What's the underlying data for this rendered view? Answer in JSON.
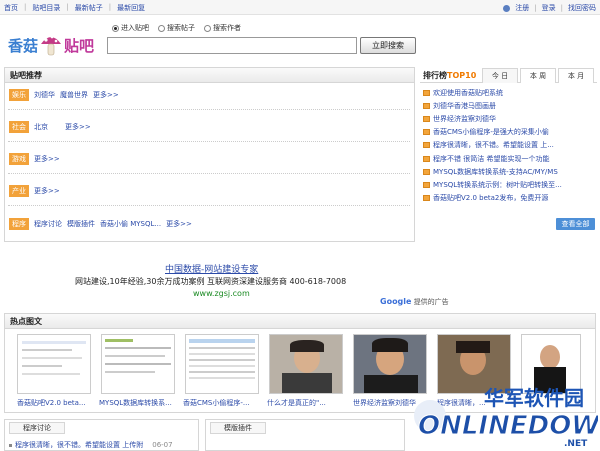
{
  "topbar": {
    "links": [
      "首页",
      "贴吧目录",
      "最新帖子",
      "最新回复"
    ],
    "register": "注册",
    "login": "登录",
    "recover": "找回密码"
  },
  "logo": {
    "part1": "香菇",
    "part2": "贴吧"
  },
  "search": {
    "options": [
      "进入贴吧",
      "搜索帖子",
      "搜索作者"
    ],
    "value": "",
    "button": "立即搜索"
  },
  "recommend": {
    "title": "贴吧推荐",
    "rows": [
      {
        "tag": "娱乐",
        "items": [
          "刘德华",
          "魔兽世界",
          "更多>>"
        ]
      },
      {
        "tag": "社会",
        "items": [
          "北京",
          "更多>>"
        ]
      },
      {
        "tag": "游戏",
        "items": [
          "更多>>"
        ]
      },
      {
        "tag": "产业",
        "items": [
          "更多>>"
        ]
      },
      {
        "tag": "程序",
        "items": [
          "程序讨论",
          "模版插件",
          "香菇小偷 MYSQL...",
          "更多>>"
        ]
      }
    ]
  },
  "rank": {
    "title": "排行榜",
    "title_hl": "TOP10",
    "tabs": [
      "今 日",
      "本 周",
      "本 月"
    ],
    "items": [
      "欢迎使用香菇贴吧系统",
      "刘德华香港马图画册",
      "世界经济监察刘德华",
      "香菇CMS小偷程序-是强大的采集小偷",
      "程序很清晰，很不错。希望能设置 上...",
      "程序不错 很简洁 希望能实现一个功能",
      "MYSQL数据库转换系统-支持AC/MY/MS",
      "MYSQL转换系统示例：树叶贴吧转换至...",
      "香菇贴吧V2.0 beta2发布，免费开源"
    ],
    "view_all": "查看全部"
  },
  "ad": {
    "title": "中国数据-网站建设专家",
    "text": "网站建设,10年经验,30余万成功案例  互联网资深建设服务商  400-618-7008",
    "url": "www.zgsj.com",
    "google": "Google",
    "google_sub": "提供的广告"
  },
  "hot": {
    "title": "热点图文",
    "captions": [
      "香菇贴吧V2.0 beta...",
      "MYSQL数据库转换系...",
      "香菇CMS小偷程序-...",
      "什么才是真正的\"...",
      "世界经济监察刘德华",
      "程序很清晰，...",
      "",
      ""
    ]
  },
  "bottom": {
    "tabs": [
      "程序讨论",
      "模版插件"
    ],
    "row_text": "程序很清晰，很不错。希望能设置 上传附",
    "row_time": "06-07"
  },
  "watermark": {
    "cn": "华军软件园",
    "en": "ONLINEDOWN",
    "tld": ".NET"
  }
}
